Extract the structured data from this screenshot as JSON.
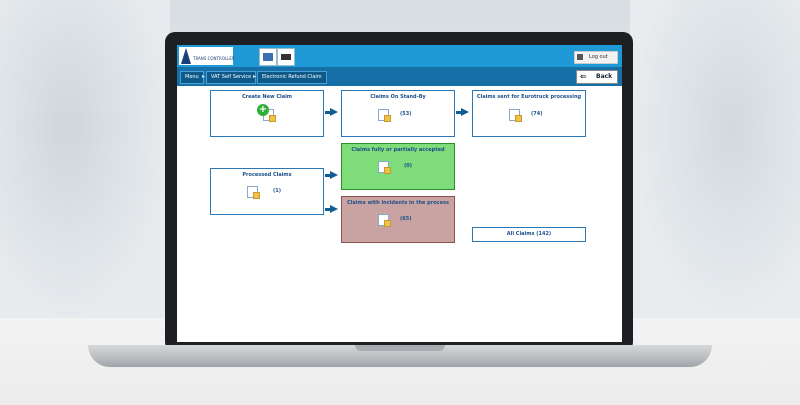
{
  "header": {
    "logo_text": "TRANS CONTROLLER",
    "logout_label": "Log out"
  },
  "breadcrumb": {
    "items": [
      "Menu",
      "VAT Self Service",
      "Electronic Refund Claim"
    ],
    "back_label": "Back"
  },
  "dashboard": {
    "create_new_claim": {
      "title": "Create New Claim"
    },
    "stand_by": {
      "title": "Claims On Stand-By",
      "count": "(53)"
    },
    "sent": {
      "title": "Claims sent for Eurotruck processing",
      "count": "(74)"
    },
    "processed": {
      "title": "Processed Claims",
      "count": "(1)"
    },
    "accepted": {
      "title": "Claims fully or partially accepted",
      "count": "(0)"
    },
    "incidents": {
      "title": "Claims with incidents in the process",
      "count": "(65)"
    },
    "all_claims": {
      "label": "All Claims (142)"
    }
  },
  "colors": {
    "header_bg": "#1f99d6",
    "nav_bg": "#166fa6",
    "box_border": "#2a78b8",
    "accepted_bg": "#7fdc7a",
    "incidents_bg": "#c9a3a1",
    "arrow": "#0f5e93"
  }
}
